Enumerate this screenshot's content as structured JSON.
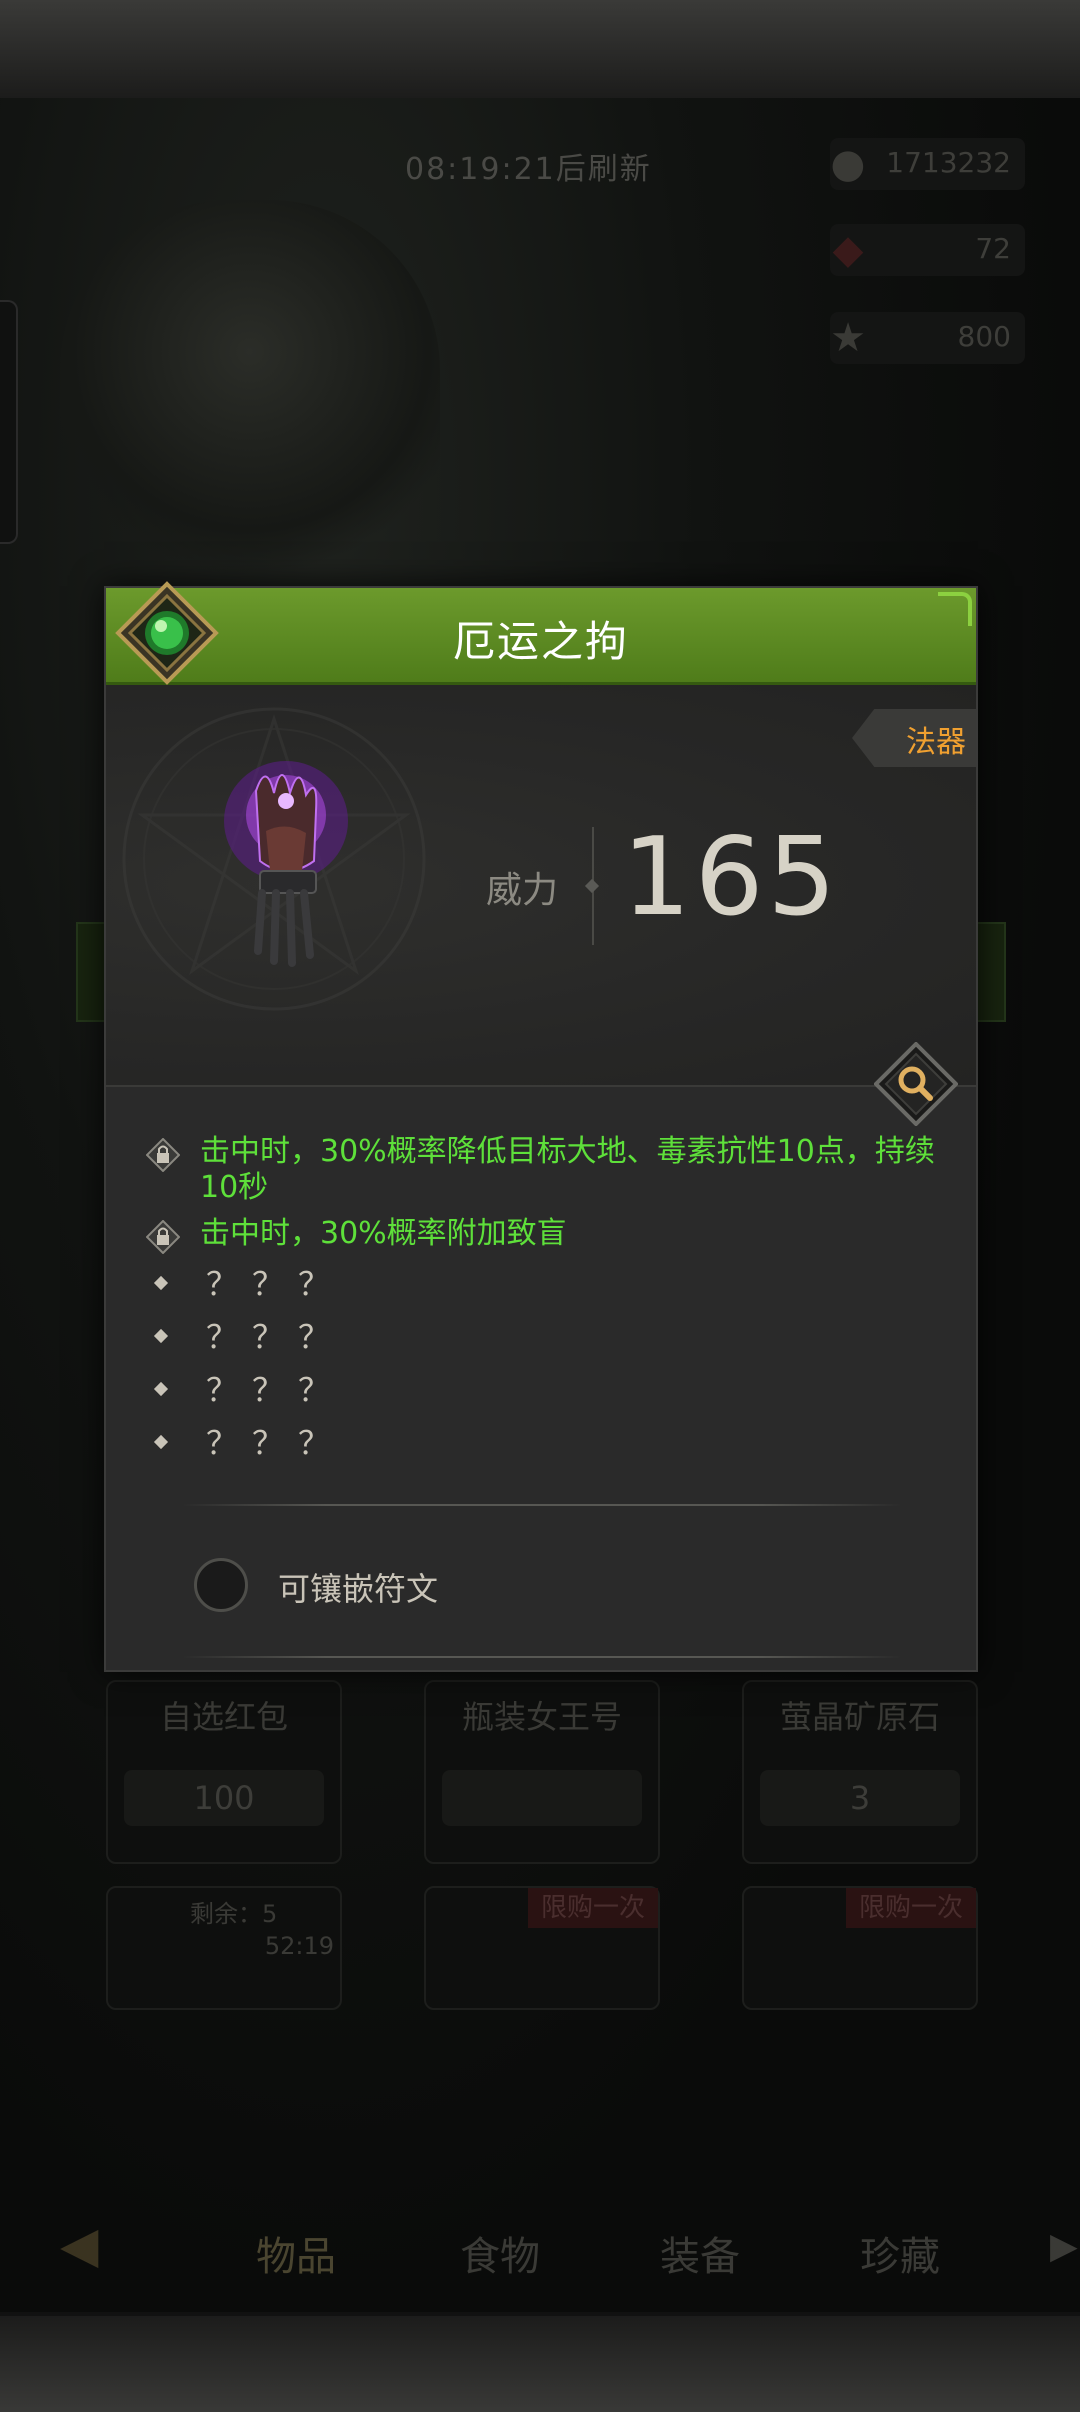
{
  "shop": {
    "refresh_timer": "08:19:21后刷新",
    "resources": [
      {
        "icon": "coin-icon",
        "value": "1713232"
      },
      {
        "icon": "ruby-icon",
        "value": "72"
      },
      {
        "icon": "star-icon",
        "value": "800"
      }
    ],
    "cards": [
      {
        "title": "自选红包",
        "price": "100"
      },
      {
        "title": "瓶装女王号",
        "price": ""
      },
      {
        "title": "萤晶矿原石",
        "price": "3"
      }
    ],
    "remaining_label": "剩余：5",
    "remaining_time": "52:19",
    "limit_badge": "限购一次",
    "tabs": [
      "物品",
      "食物",
      "装备",
      "珍藏"
    ]
  },
  "item": {
    "name": "厄运之拘",
    "type": "法器",
    "power_label": "威力",
    "power_value": "165",
    "locked_attrs": [
      "击中时，30%概率降低目标大地、毒素抗性10点，持续10秒",
      "击中时，30%概率附加致盲"
    ],
    "unknown_attrs": [
      "？？？",
      "？？？",
      "？？？",
      "？？？"
    ],
    "rune_label": "可镶嵌符文"
  },
  "colors": {
    "header_green": "#5e8c24",
    "attr_green": "#5ee03a",
    "type_orange": "#f0a030",
    "power_text": "#d6d2c6"
  }
}
